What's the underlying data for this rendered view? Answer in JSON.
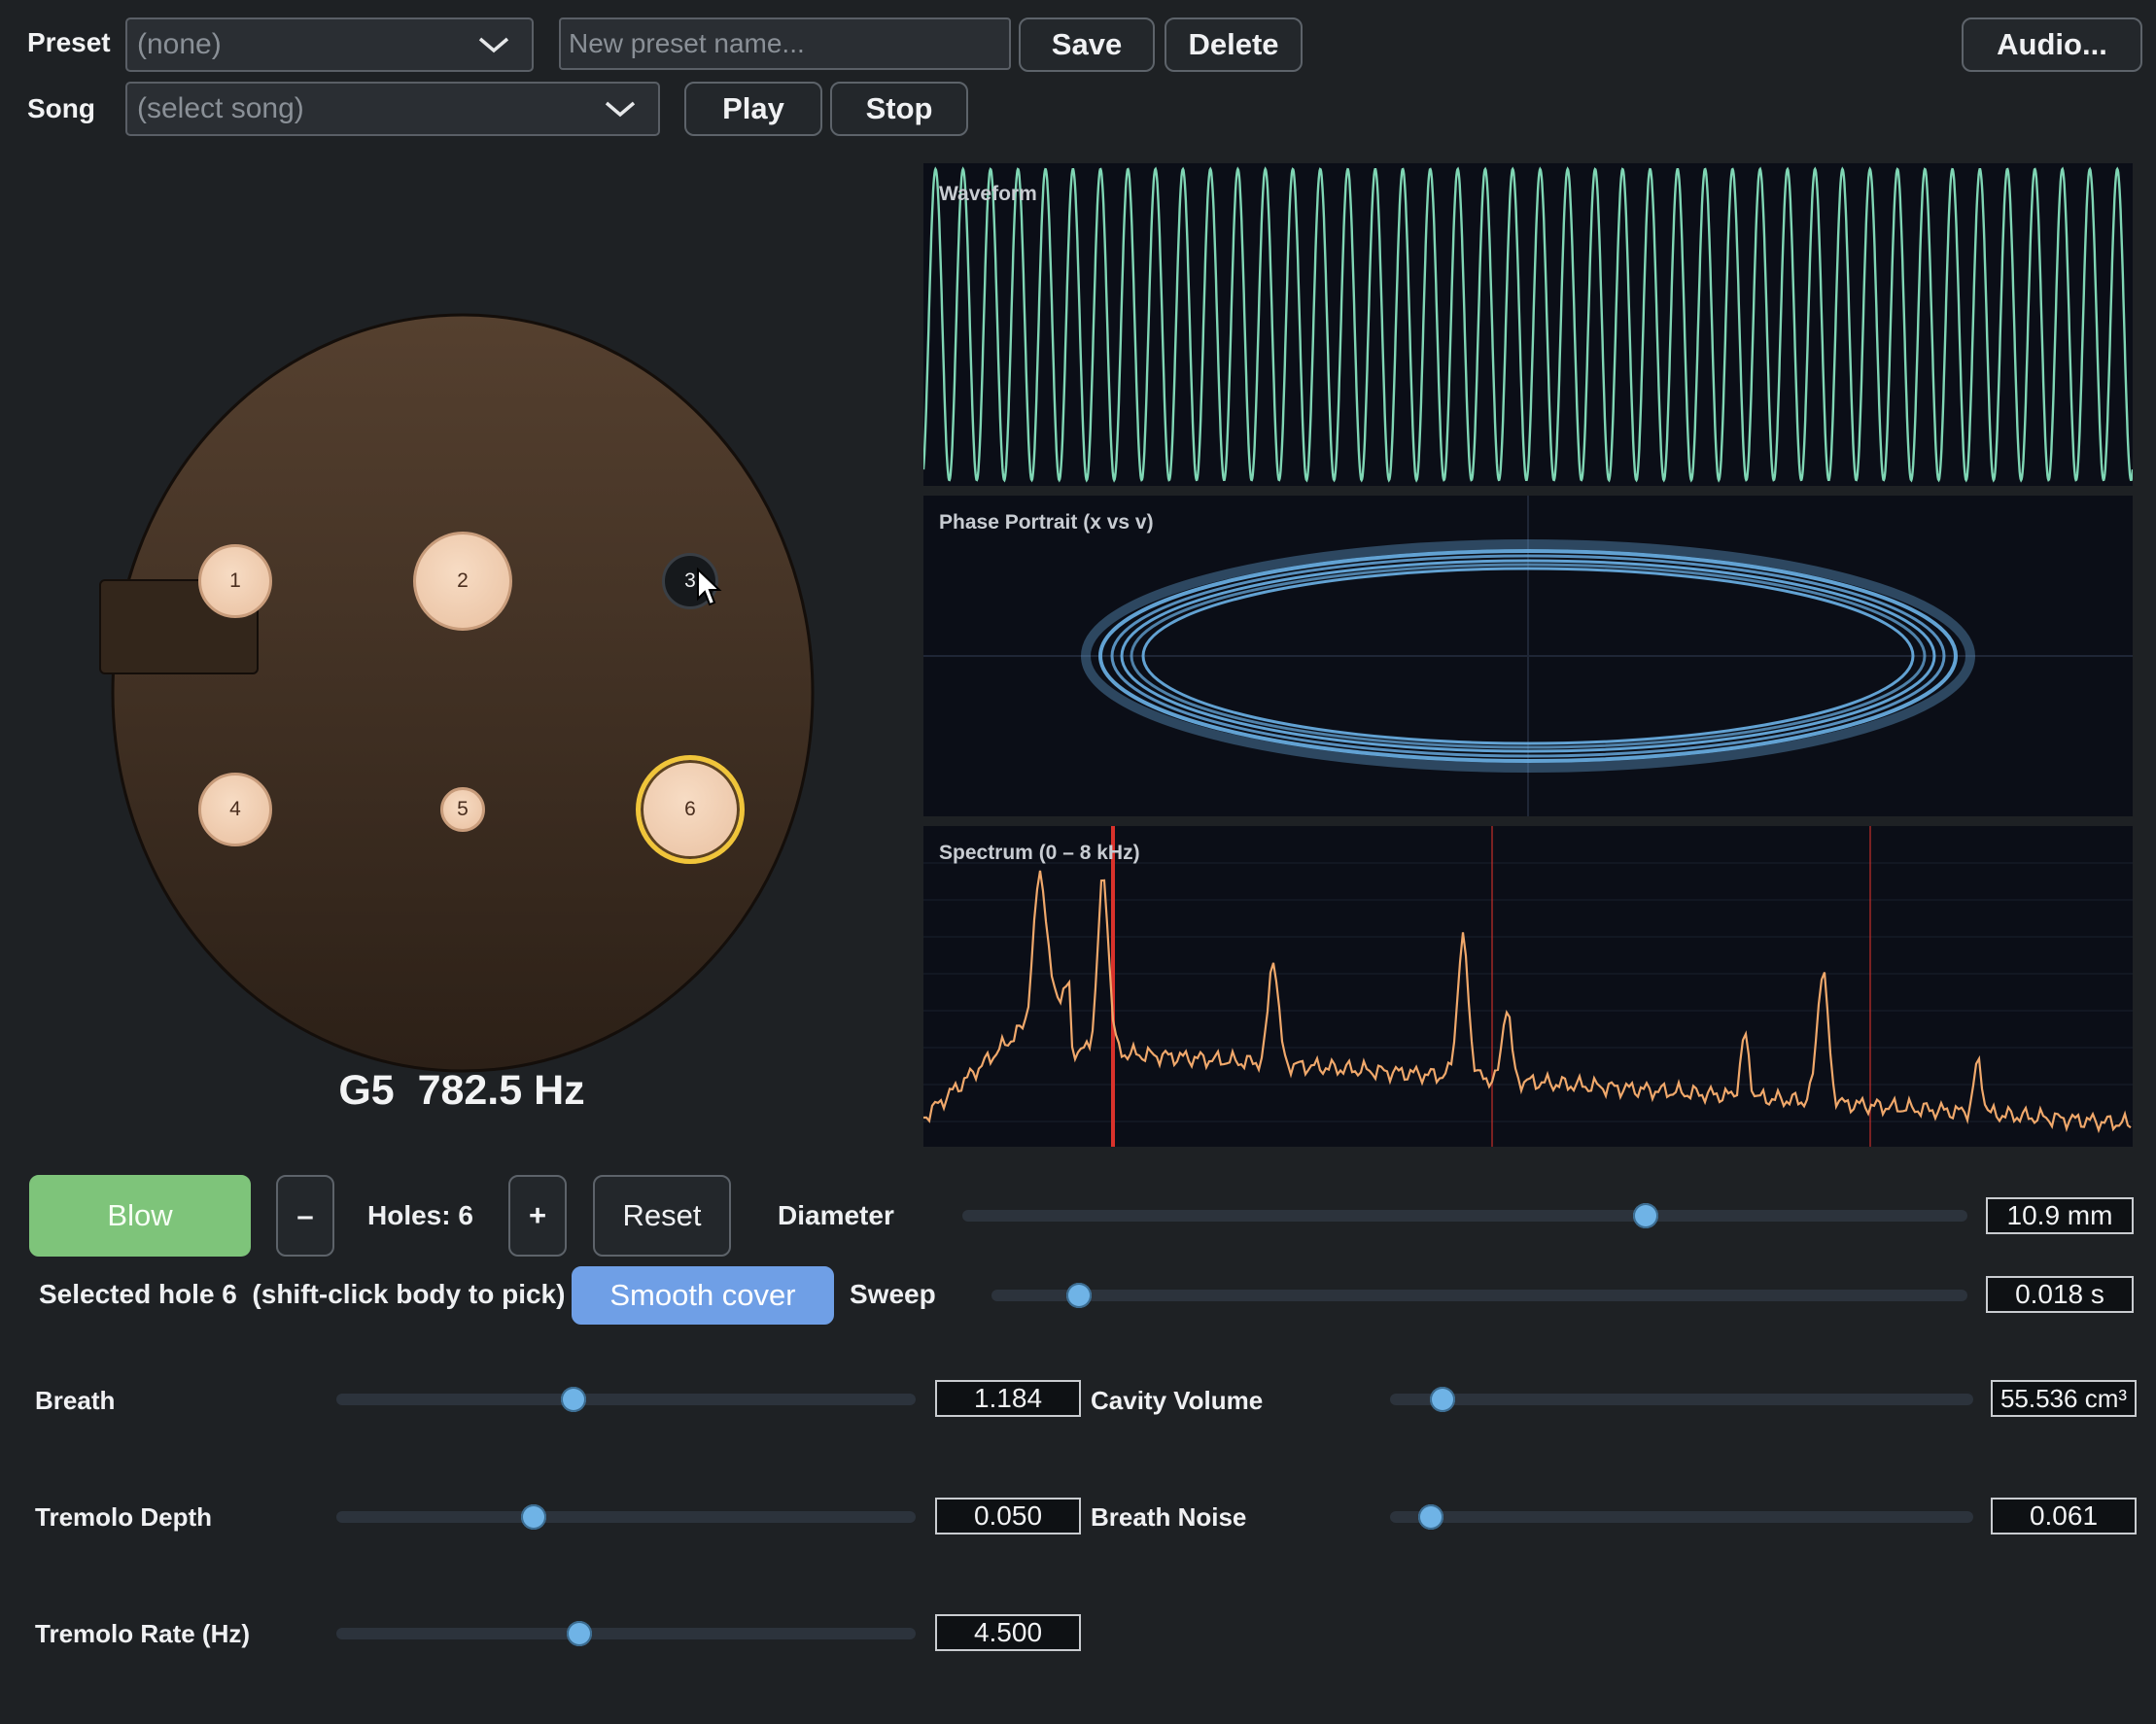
{
  "toolbar": {
    "preset_label": "Preset",
    "preset_value": "(none)",
    "preset_name_placeholder": "New preset name...",
    "save_label": "Save",
    "delete_label": "Delete",
    "audio_label": "Audio...",
    "song_label": "Song",
    "song_value": "(select song)",
    "play_label": "Play",
    "stop_label": "Stop"
  },
  "instrument": {
    "note_readout": "G5  782.5 Hz",
    "holes": [
      {
        "label": "1",
        "covered": false
      },
      {
        "label": "2",
        "covered": false
      },
      {
        "label": "3",
        "covered": true
      },
      {
        "label": "4",
        "covered": false
      },
      {
        "label": "5",
        "covered": false
      },
      {
        "label": "6",
        "covered": false,
        "selected": true
      }
    ]
  },
  "plots": {
    "waveform_title": "Waveform",
    "phase_title": "Phase Portrait  (x vs v)",
    "spectrum_title": "Spectrum  (0 – 8 kHz)"
  },
  "controls": {
    "blow_label": "Blow",
    "minus_label": "–",
    "holes_label": "Holes: 6",
    "plus_label": "+",
    "reset_label": "Reset",
    "diameter_label": "Diameter",
    "diameter_value": "10.9 mm",
    "diameter_level": 0.68,
    "selected_text": "Selected hole 6  (shift-click body to pick)",
    "smooth_cover_label": "Smooth cover",
    "sweep_label": "Sweep",
    "sweep_value": "0.018 s",
    "sweep_level": 0.09
  },
  "params": [
    {
      "label": "Breath",
      "value": "1.184",
      "level": 0.41
    },
    {
      "label": "Tremolo Depth",
      "value": "0.050",
      "level": 0.34
    },
    {
      "label": "Tremolo Rate (Hz)",
      "value": "4.500",
      "level": 0.42
    },
    {
      "label": "Cavity Volume",
      "value": "55.536 cm³",
      "level": 0.09
    },
    {
      "label": "Breath Noise",
      "value": "0.061",
      "level": 0.07
    }
  ],
  "colors": {
    "waveform": "#7fd6b4",
    "phase": "#6cb2e8",
    "spectrum": "#f0a86b",
    "marker": "#d9322b",
    "blow": "#7ec47a",
    "smooth_cover": "#6f9fe6"
  }
}
